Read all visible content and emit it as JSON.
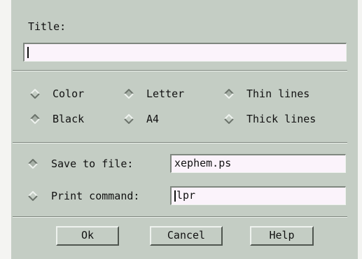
{
  "title": {
    "label": "Title:",
    "value": ""
  },
  "options": {
    "color": "Color",
    "black": "Black",
    "letter": "Letter",
    "a4": "A4",
    "thin_lines": "Thin lines",
    "thick_lines": "Thick lines"
  },
  "output": {
    "save_label": "Save to file:",
    "save_value": "xephem.ps",
    "print_label": "Print command:",
    "print_value": "lpr"
  },
  "buttons": {
    "ok": "Ok",
    "cancel": "Cancel",
    "help": "Help"
  },
  "colors": {
    "dialog_bg": "#c4cdc4",
    "field_bg": "#fbf3fb",
    "shadow": "#7f877f",
    "highlight": "#eef2ee"
  }
}
